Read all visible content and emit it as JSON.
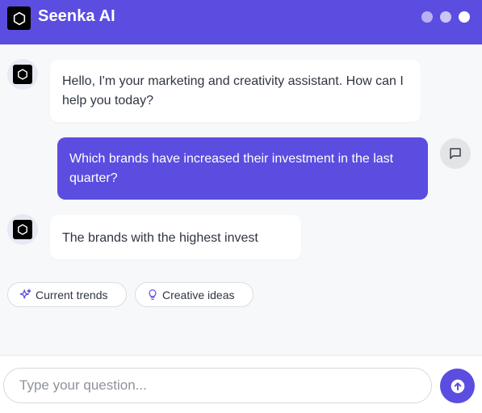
{
  "header": {
    "title": "Seenka AI",
    "logo_icon": "openai-knot-icon",
    "window_dots": [
      "#b9b0f2",
      "#cbc5f5",
      "#ffffff"
    ]
  },
  "messages": [
    {
      "role": "assistant",
      "text": "Hello, I'm your marketing and creativity assistant. How can I help you today?"
    },
    {
      "role": "user",
      "text": "Which brands have increased their investment in the last quarter?"
    },
    {
      "role": "assistant",
      "text": "The brands with the highest invest"
    }
  ],
  "suggestions": [
    {
      "label": "Current trends",
      "icon": "sparkle-icon"
    },
    {
      "label": "Creative ideas",
      "icon": "lightbulb-icon"
    }
  ],
  "composer": {
    "placeholder": "Type your question...",
    "send_icon": "arrow-up-circle-icon"
  },
  "colors": {
    "accent": "#5b4de0",
    "background": "#f7f8fa"
  }
}
